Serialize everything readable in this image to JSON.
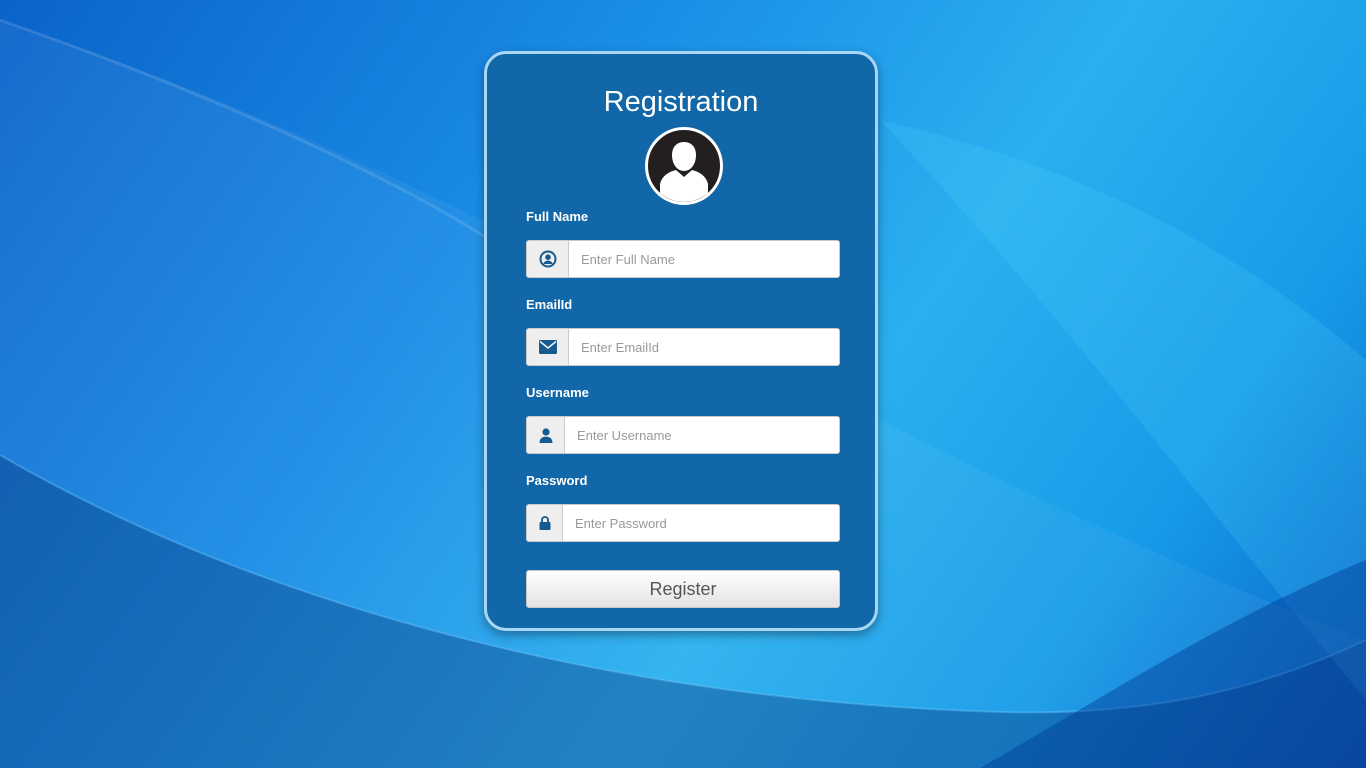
{
  "form": {
    "title": "Registration",
    "fields": [
      {
        "label": "Full Name",
        "placeholder": "Enter Full Name",
        "icon": "user-circle-icon",
        "type": "text"
      },
      {
        "label": "EmailId",
        "placeholder": "Enter EmailId",
        "icon": "envelope-icon",
        "type": "email"
      },
      {
        "label": "Username",
        "placeholder": "Enter Username",
        "icon": "user-icon",
        "type": "text"
      },
      {
        "label": "Password",
        "placeholder": "Enter Password",
        "icon": "lock-icon",
        "type": "password"
      }
    ],
    "submit_label": "Register"
  },
  "colors": {
    "card_background": "#1167a7",
    "card_border": "#a9d6f5",
    "icon_color": "#175a8e",
    "avatar_background": "#231f1f"
  }
}
